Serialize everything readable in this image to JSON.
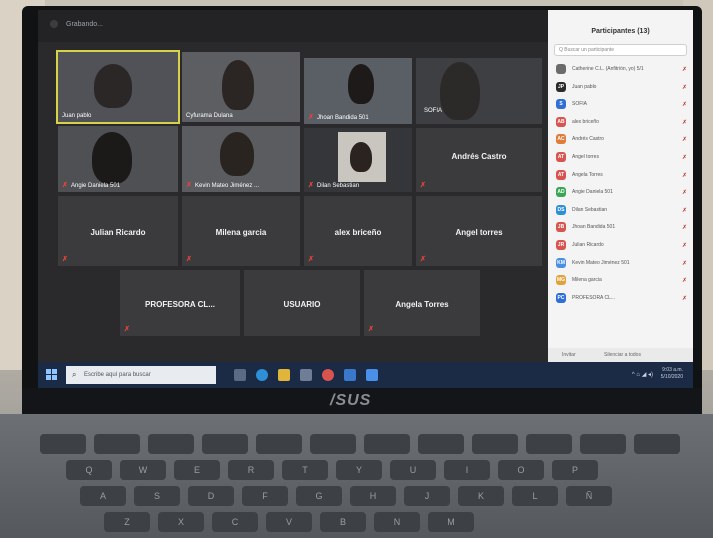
{
  "window": {
    "title": "Grabando..."
  },
  "gallery": {
    "tiles": [
      {
        "id": "t1",
        "name": "Juan pablo",
        "video": true,
        "active": true,
        "muted": false
      },
      {
        "id": "t2",
        "name": "Cyfurama Dulana",
        "video": true,
        "active": false,
        "muted": false
      },
      {
        "id": "t3",
        "name": "Jhoan Bandida 501",
        "video": true,
        "active": false,
        "muted": true
      },
      {
        "id": "t4",
        "name": "SOFIA",
        "video": true,
        "active": false,
        "muted": false
      },
      {
        "id": "t5",
        "name": "Angie Daniela 501",
        "video": true,
        "active": false,
        "muted": true
      },
      {
        "id": "t6",
        "name": "Kevin Mateo Jiménez ...",
        "video": true,
        "active": false,
        "muted": true
      },
      {
        "id": "t7",
        "name": "Dilan Sebastian",
        "video": true,
        "active": false,
        "muted": true
      },
      {
        "id": "t8",
        "name": "Andrés Castro",
        "video": false,
        "muted": true
      },
      {
        "id": "t9",
        "name": "Julian Ricardo",
        "video": false,
        "muted": true
      },
      {
        "id": "t10",
        "name": "Milena garcia",
        "video": false,
        "muted": true
      },
      {
        "id": "t11",
        "name": "alex briceño",
        "video": false,
        "muted": true
      },
      {
        "id": "t12",
        "name": "Angel torres",
        "video": false,
        "muted": true
      },
      {
        "id": "t13",
        "name": "PROFESORA CL...",
        "video": false,
        "muted": true
      },
      {
        "id": "t14",
        "name": "USUARIO",
        "video": false,
        "muted": false
      },
      {
        "id": "t15",
        "name": "Angela Torres",
        "video": false,
        "muted": true
      }
    ]
  },
  "participants_panel": {
    "title": "Participantes (13)",
    "search_placeholder": "Q Buscar un participante",
    "items": [
      {
        "initials": "",
        "name": "Catherine C.L. (Anfitrión, yo) 5/1",
        "color": "#6b6b6b"
      },
      {
        "initials": "JP",
        "name": "Juan pablo",
        "color": "#2b2b2b"
      },
      {
        "initials": "S",
        "name": "SOFIA",
        "color": "#2f6fd6"
      },
      {
        "initials": "AB",
        "name": "alex briceño",
        "color": "#d9534f"
      },
      {
        "initials": "AC",
        "name": "Andrés Castro",
        "color": "#e07b39"
      },
      {
        "initials": "AT",
        "name": "Angel torres",
        "color": "#d9534f"
      },
      {
        "initials": "AT",
        "name": "Angela Torres",
        "color": "#d9534f"
      },
      {
        "initials": "AD",
        "name": "Angie Daniela 501",
        "color": "#3aa655"
      },
      {
        "initials": "DS",
        "name": "Dilan Sebastian",
        "color": "#2f8fd6"
      },
      {
        "initials": "JB",
        "name": "Jhoan Bandida 501",
        "color": "#d9534f"
      },
      {
        "initials": "JR",
        "name": "Julian Ricardo",
        "color": "#d9534f"
      },
      {
        "initials": "KM",
        "name": "Kevin Mateo Jiménez 501",
        "color": "#4a90e2"
      },
      {
        "initials": "MG",
        "name": "Milena garcia",
        "color": "#e0a23a"
      },
      {
        "initials": "PC",
        "name": "PROFESORA CL...",
        "color": "#2f6fd6"
      }
    ],
    "footer": {
      "invite": "Invitar",
      "mute_all": "Silenciar a todos"
    }
  },
  "taskbar": {
    "search_placeholder": "Escribe aquí para buscar",
    "time": "9:03 a.m.",
    "date": "5/10/2020",
    "colors": {
      "bar": "#1b2a45",
      "start": "#8fc6ff"
    },
    "icons": [
      "task-view-icon",
      "edge-icon",
      "file-explorer-icon",
      "store-icon",
      "chrome-icon",
      "mail-icon",
      "zoom-icon"
    ]
  },
  "brand": {
    "logo": "/SUS"
  },
  "keyboard": {
    "rows": [
      [
        "Q",
        "W",
        "E",
        "R",
        "T",
        "Y",
        "U",
        "I",
        "O",
        "P"
      ],
      [
        "A",
        "S",
        "D",
        "F",
        "G",
        "H",
        "J",
        "K",
        "L",
        "Ñ"
      ],
      [
        "Z",
        "X",
        "C",
        "V",
        "B",
        "N",
        "M"
      ]
    ]
  }
}
